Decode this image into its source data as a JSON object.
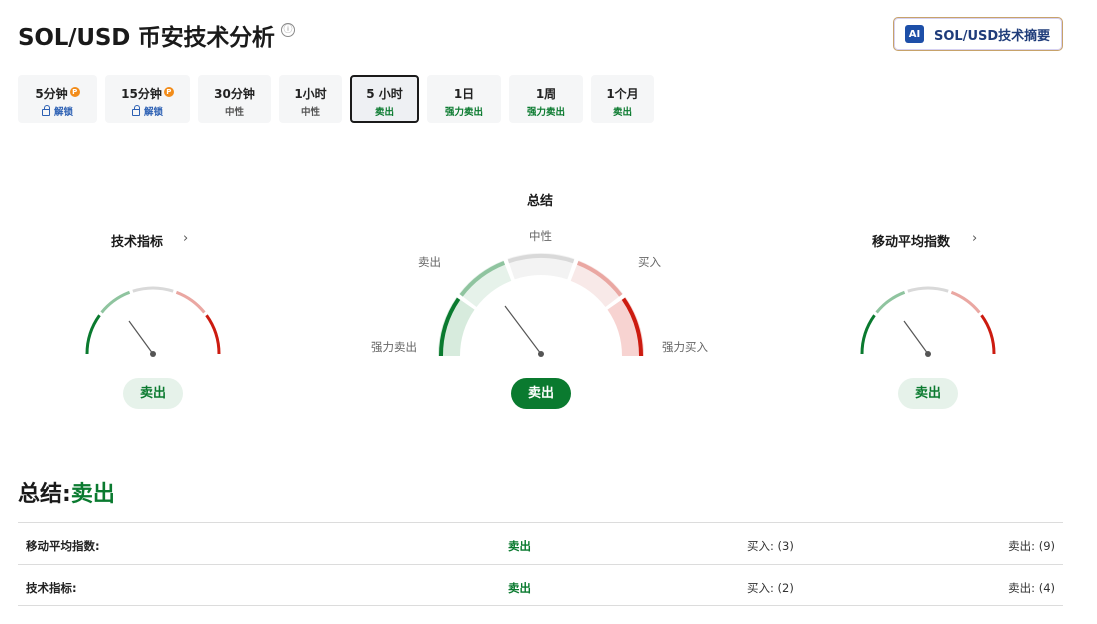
{
  "header": {
    "title": "SOL/USD 币安技术分析",
    "info_icon": "ⓘ",
    "ai_badge": "AI",
    "ai_button_label": "SOL/USD技术摘要"
  },
  "timeframes": [
    {
      "label": "5分钟",
      "sub": "解锁",
      "locked": true
    },
    {
      "label": "15分钟",
      "sub": "解锁",
      "locked": true
    },
    {
      "label": "30分钟",
      "sub": "中性",
      "locked": false
    },
    {
      "label": "1小时",
      "sub": "中性",
      "locked": false
    },
    {
      "label": "5 小时",
      "sub": "卖出",
      "locked": false,
      "active": true
    },
    {
      "label": "1日",
      "sub": "强力卖出",
      "locked": false
    },
    {
      "label": "1周",
      "sub": "强力卖出",
      "locked": false
    },
    {
      "label": "1个月",
      "sub": "卖出",
      "locked": false
    }
  ],
  "pro_icon_glyph": "P",
  "gauges": {
    "technical": {
      "title": "技术指标",
      "chevron": "›",
      "verdict": "卖出"
    },
    "summary": {
      "title": "总结",
      "verdict": "卖出",
      "labels": {
        "strong_sell": "强力卖出",
        "sell": "卖出",
        "neutral": "中性",
        "buy": "买入",
        "strong_buy": "强力买入"
      }
    },
    "moving_averages": {
      "title": "移动平均指数",
      "chevron": "›",
      "verdict": "卖出"
    }
  },
  "summary": {
    "label": "总结:",
    "value": "卖出",
    "rows": [
      {
        "name": "移动平均指数:",
        "verdict": "卖出",
        "buy": "买入: (3)",
        "sell": "卖出: (9)"
      },
      {
        "name": "技术指标:",
        "verdict": "卖出",
        "buy": "买入: (2)",
        "sell": "卖出: (4)"
      }
    ]
  },
  "colors": {
    "strong_sell": "#0a7a2f",
    "sell": "#8fc49f",
    "neutral": "#d9d9d9",
    "buy": "#eaa7a2",
    "strong_buy": "#cc1b10"
  }
}
